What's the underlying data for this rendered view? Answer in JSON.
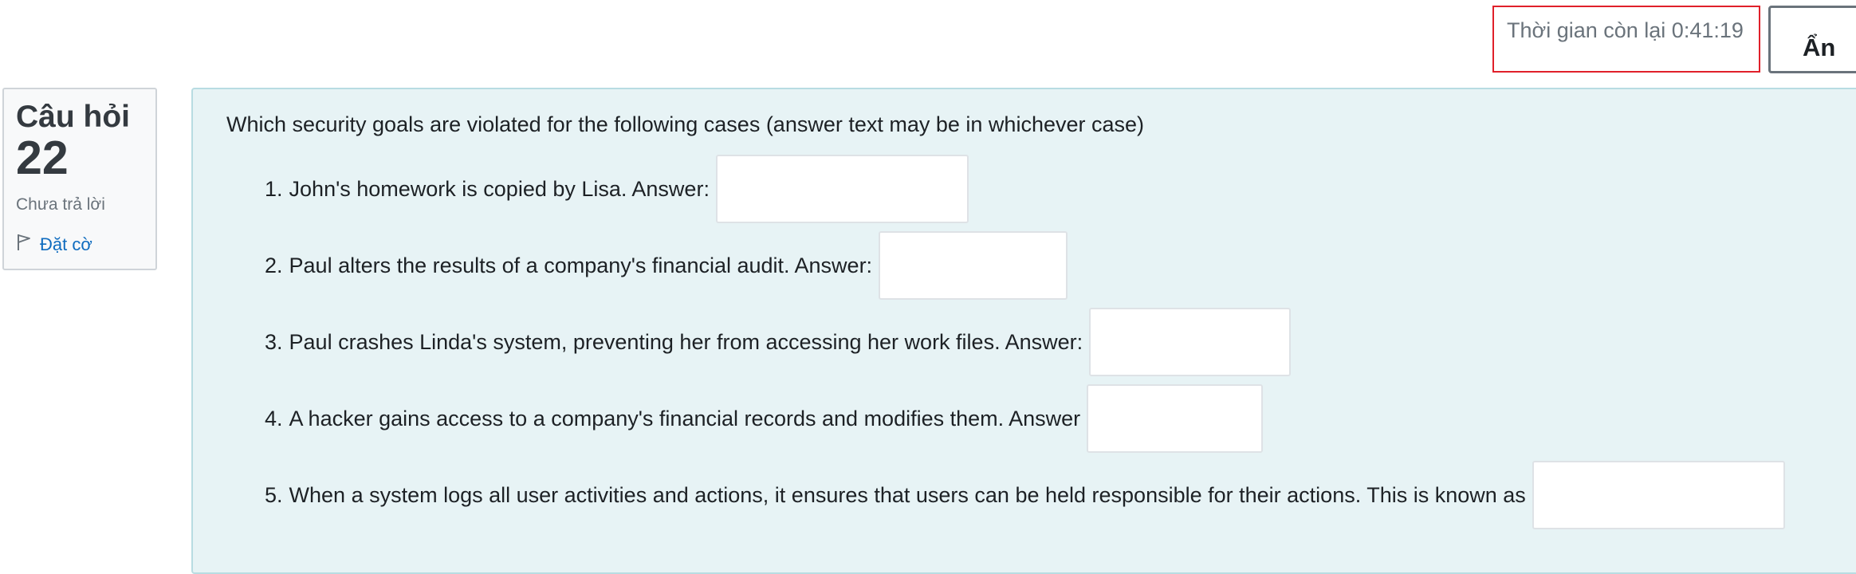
{
  "timer": {
    "label": "Thời gian còn lại 0:41:19"
  },
  "hide_button": {
    "label": "Ẩn"
  },
  "question_info": {
    "label": "Câu hỏi",
    "number": "22",
    "state": "Chưa trả lời",
    "flag_label": "Đặt cờ",
    "flag_icon": "flag-icon"
  },
  "question": {
    "prompt": "Which security goals are violated for the following cases (answer text may be in whichever case)",
    "items": [
      {
        "num": "1.",
        "text": "John's homework is copied by Lisa. Answer:",
        "value": ""
      },
      {
        "num": "2.",
        "text": "Paul alters the results of a company's financial audit. Answer:",
        "value": ""
      },
      {
        "num": "3.",
        "text": "Paul crashes Linda's system, preventing her from accessing her work files. Answer:",
        "value": ""
      },
      {
        "num": "4.",
        "text": "A hacker gains access to a company's financial records and modifies them. Answer",
        "value": ""
      },
      {
        "num": "5.",
        "text": "When a system logs all user activities and actions, it ensures that users can be held responsible for their actions. This is known as",
        "value": ""
      }
    ]
  },
  "colors": {
    "timer_border": "#e0202a",
    "panel_background": "#e7f3f5",
    "link": "#0f6cbf"
  }
}
